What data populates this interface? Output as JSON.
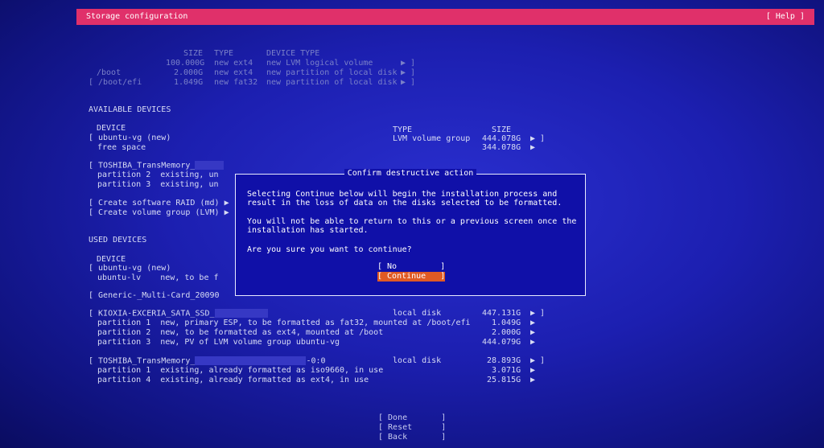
{
  "header": {
    "title": "Storage configuration",
    "help": "[ Help ]"
  },
  "summary": {
    "headers": {
      "size": "SIZE",
      "type": "TYPE",
      "devtype": "DEVICE TYPE"
    },
    "rows": [
      {
        "mount": "",
        "size": "100.000G",
        "type": "new ext4",
        "devtype": "new LVM logical volume",
        "arrow": "▶ ]"
      },
      {
        "mount": "/boot",
        "size": "2.000G",
        "type": "new ext4",
        "devtype": "new partition of local disk",
        "arrow": "▶ ]"
      },
      {
        "mount": "[ /boot/efi",
        "size": "1.049G",
        "type": "new fat32",
        "devtype": "new partition of local disk",
        "arrow": "▶ ]"
      }
    ]
  },
  "available": {
    "heading": "AVAILABLE DEVICES",
    "col_device": "DEVICE",
    "col_type": "TYPE",
    "col_size": "SIZE",
    "vg_name": "[ ubuntu-vg (new)",
    "vg_type": "LVM volume group",
    "vg_size": "444.078G",
    "vg_arrow": "▶ ]",
    "free_label": "free space",
    "free_size": "344.078G",
    "free_arrow": "▶",
    "toshiba": "[ TOSHIBA_TransMemory_",
    "part2": "partition 2  existing, un",
    "part3": "partition 3  existing, un",
    "raid": "[ Create software RAID (md) ▶ ]",
    "lvm": "[ Create volume group (LVM) ▶ ]"
  },
  "used": {
    "heading": "USED DEVICES",
    "col_device": "DEVICE",
    "vg": "[ ubuntu-vg (new)",
    "lv": "ubuntu-lv    new, to be f",
    "generic": "[ Generic-_Multi-Card_20090",
    "kioxia": {
      "name": "[ KIOXIA-EXCERIA_SATA_SSD_",
      "type": "local disk",
      "size": "447.131G",
      "arrow": "▶ ]",
      "parts": [
        {
          "text": "partition 1  new, primary ESP, to be formatted as fat32, mounted at /boot/efi",
          "size": "1.049G",
          "arrow": "▶"
        },
        {
          "text": "partition 2  new, to be formatted as ext4, mounted at /boot",
          "size": "2.000G",
          "arrow": "▶"
        },
        {
          "text": "partition 3  new, PV of LVM volume group ubuntu-vg",
          "size": "444.079G",
          "arrow": "▶"
        }
      ]
    },
    "toshiba": {
      "name": "[ TOSHIBA_TransMemory_",
      "suffix": "-0:0",
      "type": "local disk",
      "size": "28.893G",
      "arrow": "▶ ]",
      "parts": [
        {
          "text": "partition 1  existing, already formatted as iso9660, in use",
          "size": "3.071G",
          "arrow": "▶"
        },
        {
          "text": "partition 4  existing, already formatted as ext4, in use",
          "size": "25.815G",
          "arrow": "▶"
        }
      ]
    }
  },
  "dialog": {
    "title": "Confirm destructive action",
    "line1": "Selecting Continue below will begin the installation process and",
    "line2": "result in the loss of data on the disks selected to be formatted.",
    "line3": "You will not be able to return to this or a previous screen once the",
    "line4": "installation has started.",
    "question": "Are you sure you want to continue?",
    "no": "[ No         ]",
    "continue": "[ Continue   ]"
  },
  "footer": {
    "done": "[ Done       ]",
    "reset": "[ Reset      ]",
    "back": "[ Back       ]"
  }
}
